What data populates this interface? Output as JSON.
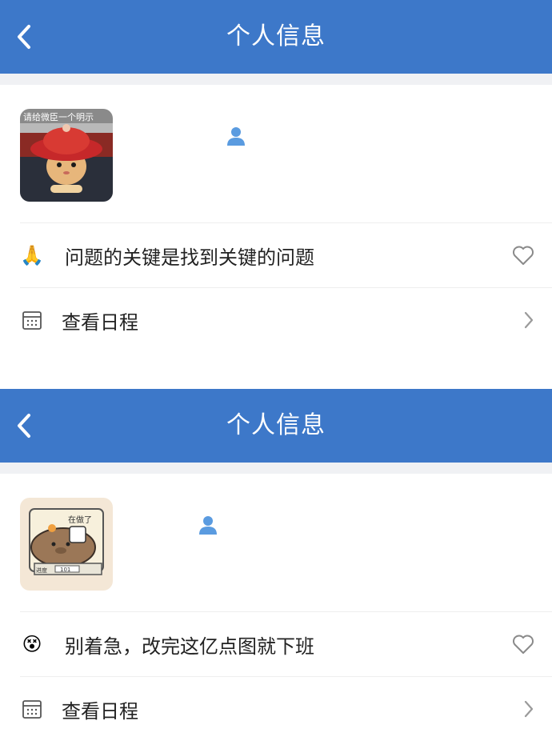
{
  "screens": [
    {
      "title": "个人信息",
      "avatar_text": "请给微臣一个明示",
      "status_emoji": "🙏",
      "status_text": "问题的关键是找到关键的问题",
      "schedule_label": "查看日程"
    },
    {
      "title": "个人信息",
      "avatar_text": "在做了",
      "avatar_text_2": "进度",
      "avatar_text_3": "101",
      "status_emoji": "😵",
      "status_text": "别着急，改完这亿点图就下班",
      "schedule_label": "查看日程"
    }
  ],
  "colors": {
    "header_blue": "#3d78c9",
    "user_icon_blue": "#5a9be0",
    "gap_gray": "#f0f1f4"
  },
  "icons": [
    "back-arrow-icon",
    "user-icon",
    "heart-outline-icon",
    "calendar-icon",
    "chevron-right-icon"
  ]
}
